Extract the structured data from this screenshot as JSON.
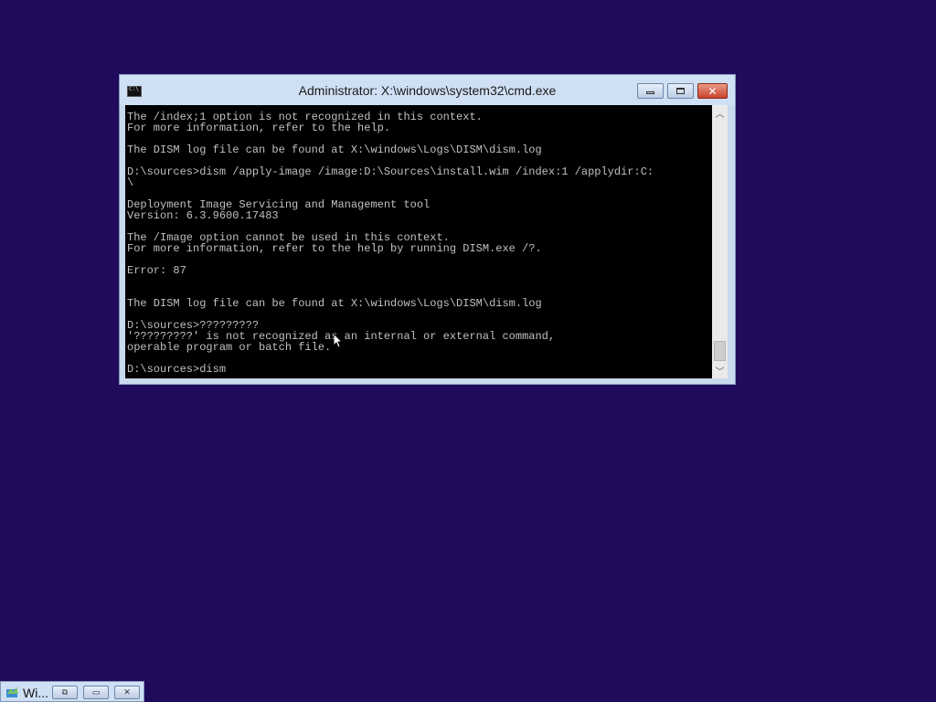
{
  "window": {
    "title": "Administrator: X:\\windows\\system32\\cmd.exe",
    "minimize_glyph": "",
    "close_glyph": "✕"
  },
  "console": {
    "lines": [
      "The /index;1 option is not recognized in this context.",
      "For more information, refer to the help.",
      "",
      "The DISM log file can be found at X:\\windows\\Logs\\DISM\\dism.log",
      "",
      "D:\\sources>dism /apply-image /image:D:\\Sources\\install.wim /index:1 /applydir:C:",
      "\\",
      "",
      "Deployment Image Servicing and Management tool",
      "Version: 6.3.9600.17483",
      "",
      "The /Image option cannot be used in this context.",
      "For more information, refer to the help by running DISM.exe /?.",
      "",
      "Error: 87",
      "",
      "",
      "The DISM log file can be found at X:\\windows\\Logs\\DISM\\dism.log",
      "",
      "D:\\sources>?????????",
      "'?????????' is not recognized as an internal or external command,",
      "operable program or batch file.",
      "",
      "D:\\sources>dism"
    ]
  },
  "scrollbar": {
    "up_glyph": "︿",
    "down_glyph": "﹀"
  },
  "taskbar_item": {
    "label": "Wi...",
    "restore_glyph": "⧉",
    "max_glyph": "▭",
    "close_glyph": "✕"
  },
  "colors": {
    "desktop": "#200a5c",
    "console_bg": "#000000",
    "console_fg": "#c0c0c0",
    "titlebar": "#cfe0f4",
    "close_button": "#c9442c"
  }
}
